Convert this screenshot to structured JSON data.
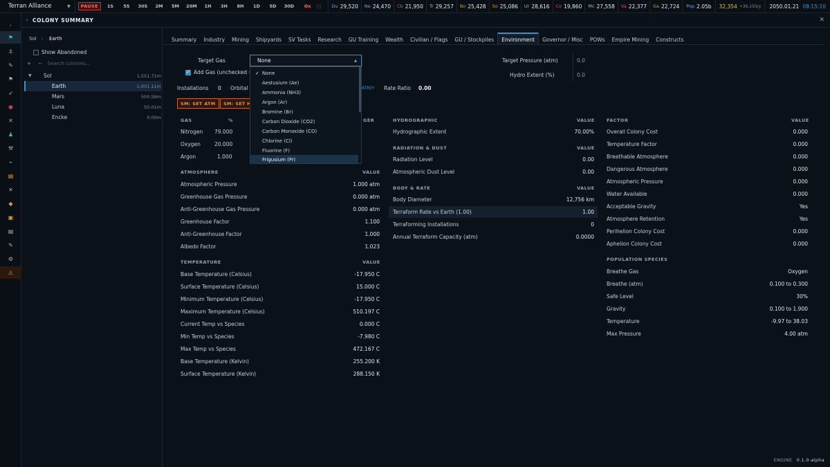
{
  "topbar": {
    "empire": "Terran Alliance",
    "pause": "PAUSE",
    "speeds": [
      "1S",
      "5S",
      "30S",
      "2M",
      "5M",
      "20M",
      "1H",
      "3H",
      "8H",
      "1D",
      "5D",
      "30D"
    ],
    "ox": "Ox",
    "minerals": [
      {
        "sym": "Du",
        "value": "29,520",
        "color": "#7aa8d8"
      },
      {
        "sym": "Ne",
        "value": "24,470",
        "color": "#7aa8d8"
      },
      {
        "sym": "Cb",
        "value": "21,950",
        "color": "#d85a5a"
      },
      {
        "sym": "Tr",
        "value": "29,257",
        "color": "#8fd07a"
      },
      {
        "sym": "Bo",
        "value": "25,428",
        "color": "#c9a44a"
      },
      {
        "sym": "So",
        "value": "25,086",
        "color": "#d8a23a"
      },
      {
        "sym": "Ur",
        "value": "28,616",
        "color": "#8fd07a"
      },
      {
        "sym": "Co",
        "value": "19,860",
        "color": "#d85a5a"
      },
      {
        "sym": "Mc",
        "value": "27,558",
        "color": "#8fd07a"
      },
      {
        "sym": "Va",
        "value": "22,377",
        "color": "#d85a5a"
      },
      {
        "sym": "Ga",
        "value": "22,724",
        "color": "#c9a44a"
      }
    ],
    "pop_label": "Pop",
    "pop_value": "2.05b",
    "wealth": "32,354",
    "wealth_rate": "+36,150/y",
    "date": "2050.01.21",
    "time": "08:15:10"
  },
  "panel": {
    "title": "COLONY SUMMARY"
  },
  "tree": {
    "crumb_root": "Sol",
    "crumb_leaf": "Earth",
    "show_abandoned": "Show Abandoned",
    "search_placeholder": "Search colonies...",
    "system": {
      "name": "Sol",
      "dist": "1,551.71m"
    },
    "bodies": [
      {
        "name": "Earth",
        "dist": "1,001.11m"
      },
      {
        "name": "Mars",
        "dist": "500.59m"
      },
      {
        "name": "Luna",
        "dist": "50.01m"
      },
      {
        "name": "Encke",
        "dist": "0.00m"
      }
    ]
  },
  "tabs": [
    "Summary",
    "Industry",
    "Mining",
    "Shipyards",
    "SV Tasks",
    "Research",
    "GU Training",
    "Wealth",
    "Civilian / Flags",
    "GU / Stockpiles",
    "Environment",
    "Governor / Misc",
    "POWs",
    "Empire Mining",
    "Constructs"
  ],
  "env": {
    "target_gas_label": "Target Gas",
    "target_gas_value": "None",
    "add_gas_label": "Add Gas (unchecked =",
    "installations_label": "Installations",
    "installations_value": "0",
    "orbital_label": "Orbital I",
    "atm_unit": "ATM/Y",
    "rate_ratio_label": "Rate Ratio",
    "rate_ratio_value": "0.00",
    "target_pressure_label": "Target Pressure (atm)",
    "target_pressure_value": "0.0",
    "hydro_extent_label": "Hydro Extent (%)",
    "hydro_extent_value": "0.0",
    "btn_set_atm": "SM: SET ATM",
    "btn_set_h": "SM: SET H"
  },
  "dropdown": {
    "items": [
      "None",
      "Aestusium (Ae)",
      "Ammonia (NH3)",
      "Argon (Ar)",
      "Bromine (Br)",
      "Carbon Dioxide (CO2)",
      "Carbon Monoxide (CO)",
      "Chlorine (Cl)",
      "Fluorine (F)",
      "Frigusium (Fr)"
    ]
  },
  "gas_table": {
    "headers": [
      "GAS",
      "%",
      "GER"
    ],
    "rows": [
      {
        "gas": "Nitrogen",
        "pct": "79.000"
      },
      {
        "gas": "Oxygen",
        "pct": "20.000"
      },
      {
        "gas": "Argon",
        "pct": "1.000"
      }
    ]
  },
  "atmosphere": {
    "header": "ATMOSPHERE",
    "value_header": "VALUE",
    "rows": [
      {
        "k": "Atmospheric Pressure",
        "v": "1.000 atm"
      },
      {
        "k": "Greenhouse Gas Pressure",
        "v": "0.000 atm"
      },
      {
        "k": "Anti-Greenhouse Gas Pressure",
        "v": "0.000 atm"
      },
      {
        "k": "Greenhouse Factor",
        "v": "1.100"
      },
      {
        "k": "Anti-Greenhouse Factor",
        "v": "1.000"
      },
      {
        "k": "Albedo Factor",
        "v": "1.023"
      }
    ]
  },
  "temperature": {
    "header": "TEMPERATURE",
    "value_header": "VALUE",
    "rows": [
      {
        "k": "Base Temperature (Celsius)",
        "v": "-17.950 C"
      },
      {
        "k": "Surface Temperature (Celsius)",
        "v": "15.000 C"
      },
      {
        "k": "Minimum Temperature (Celsius)",
        "v": "-17.950 C"
      },
      {
        "k": "Maximum Temperature (Celsius)",
        "v": "510.197 C"
      },
      {
        "k": "Current Temp vs Species",
        "v": "0.000 C"
      },
      {
        "k": "Min Temp vs Species",
        "v": "-7.980 C"
      },
      {
        "k": "Max Temp vs Species",
        "v": "472.167 C"
      },
      {
        "k": "Base Temperature (Kelvin)",
        "v": "255.200 K"
      },
      {
        "k": "Surface Temperature (Kelvin)",
        "v": "288.150 K"
      }
    ]
  },
  "hydrographic": {
    "header": "HYDROGRAPHIC",
    "value_header": "VALUE",
    "rows": [
      {
        "k": "Hydrographic Extent",
        "v": "70.00%"
      }
    ]
  },
  "radiation": {
    "header": "RADIATION & DUST",
    "value_header": "VALUE",
    "rows": [
      {
        "k": "Radiation Level",
        "v": "0.00"
      },
      {
        "k": "Atmospheric Dust Level",
        "v": "0.00"
      }
    ]
  },
  "body_rate": {
    "header": "BODY & RATE",
    "value_header": "VALUE",
    "rows": [
      {
        "k": "Body Diameter",
        "v": "12,756 km"
      },
      {
        "k": "Terraform Rate vs Earth (1.00)",
        "v": "1.00"
      },
      {
        "k": "Terraforming Installations",
        "v": "0"
      },
      {
        "k": "Annual Terraform Capacity (atm)",
        "v": "0.0000"
      }
    ]
  },
  "factor": {
    "header": "FACTOR",
    "value_header": "VALUE",
    "rows": [
      {
        "k": "Overall Colony Cost",
        "v": "0.000"
      },
      {
        "k": "Temperature Factor",
        "v": "0.000"
      },
      {
        "k": "Breathable Atmosphere",
        "v": "0.000"
      },
      {
        "k": "Dangerous Atmosphere",
        "v": "0.000"
      },
      {
        "k": "Atmospheric Pressure",
        "v": "0.000"
      },
      {
        "k": "Water Available",
        "v": "0.000"
      },
      {
        "k": "Acceptable Gravity",
        "v": "Yes"
      },
      {
        "k": "Atmosphere Retention",
        "v": "Yes"
      },
      {
        "k": "Perihelion Colony Cost",
        "v": "0.000"
      },
      {
        "k": "Aphelion Colony Cost",
        "v": "0.000"
      }
    ]
  },
  "species": {
    "header": "POPULATION SPECIES",
    "rows": [
      {
        "k": "Breathe Gas",
        "v": "Oxygen"
      },
      {
        "k": "Breathe (atm)",
        "v": "0.100 to 0.300"
      },
      {
        "k": "Safe Level",
        "v": "30%"
      },
      {
        "k": "Gravity",
        "v": "0.100 to 1.900"
      },
      {
        "k": "Temperature",
        "v": "-9.97 to 38.03"
      },
      {
        "k": "Max Pressure",
        "v": "4.00 atm"
      }
    ]
  },
  "footer": {
    "engine": "ENGINE",
    "version": "0.1.0-alpha"
  },
  "colors": {
    "accent": "#3d8fc7",
    "warning": "#f28b47",
    "pause": "#ff6b5e",
    "wealth": "#d8c23a"
  }
}
